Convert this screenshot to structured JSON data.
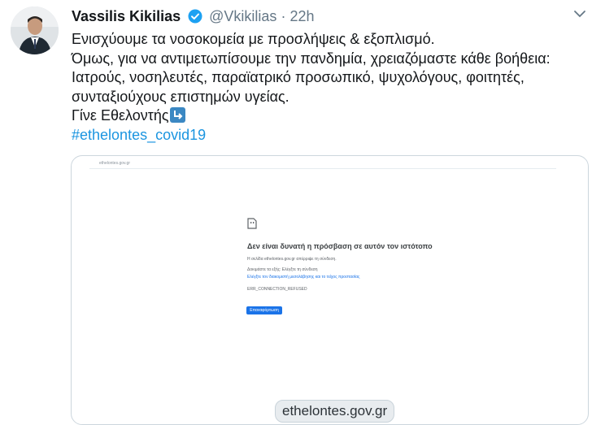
{
  "tweet": {
    "author_name": "Vassilis Kikilias",
    "handle": "@Vkikilias",
    "separator": "·",
    "time": "22h",
    "lines": [
      "Ενισχύουμε τα νοσοκομεία με προσλήψεις & εξοπλισμό.",
      "Όμως, για να αντιμετωπίσουμε την πανδημία, χρειαζόμαστε κάθε βοήθεια:",
      "Ιατρούς, νοσηλευτές, παραϊατρικό προσωπικό, ψυχολόγους, φοιτητές,",
      "συνταξιούχους επιστημών υγείας."
    ],
    "last_line": "Γίνε Εθελοντής",
    "emoji": "arrow-down-right-emoji",
    "hashtag": "#ethelontes_covid19"
  },
  "card": {
    "url": "ethelontes.gov.gr",
    "error_title": "Δεν είναι δυνατή η πρόσβαση σε αυτόν τον ιστότοπο",
    "error_detail": "Η σελίδα ethelontes.gov.gr απέρριψε τη σύνδεση.",
    "error_suggestions": "Δοκιμάστε τα εξής: Ελέγξτε τη σύνδεση",
    "error_link": "Ελέγξτε τον διακομιστή μεσολάβησης και το τείχος προστασίας",
    "error_code": "ERR_CONNECTION_REFUSED",
    "reload_label": "Επαναφόρτωση",
    "domain_label": "ethelontes.gov.gr"
  },
  "colors": {
    "link": "#1b95e0",
    "verified": "#1da1f2"
  }
}
